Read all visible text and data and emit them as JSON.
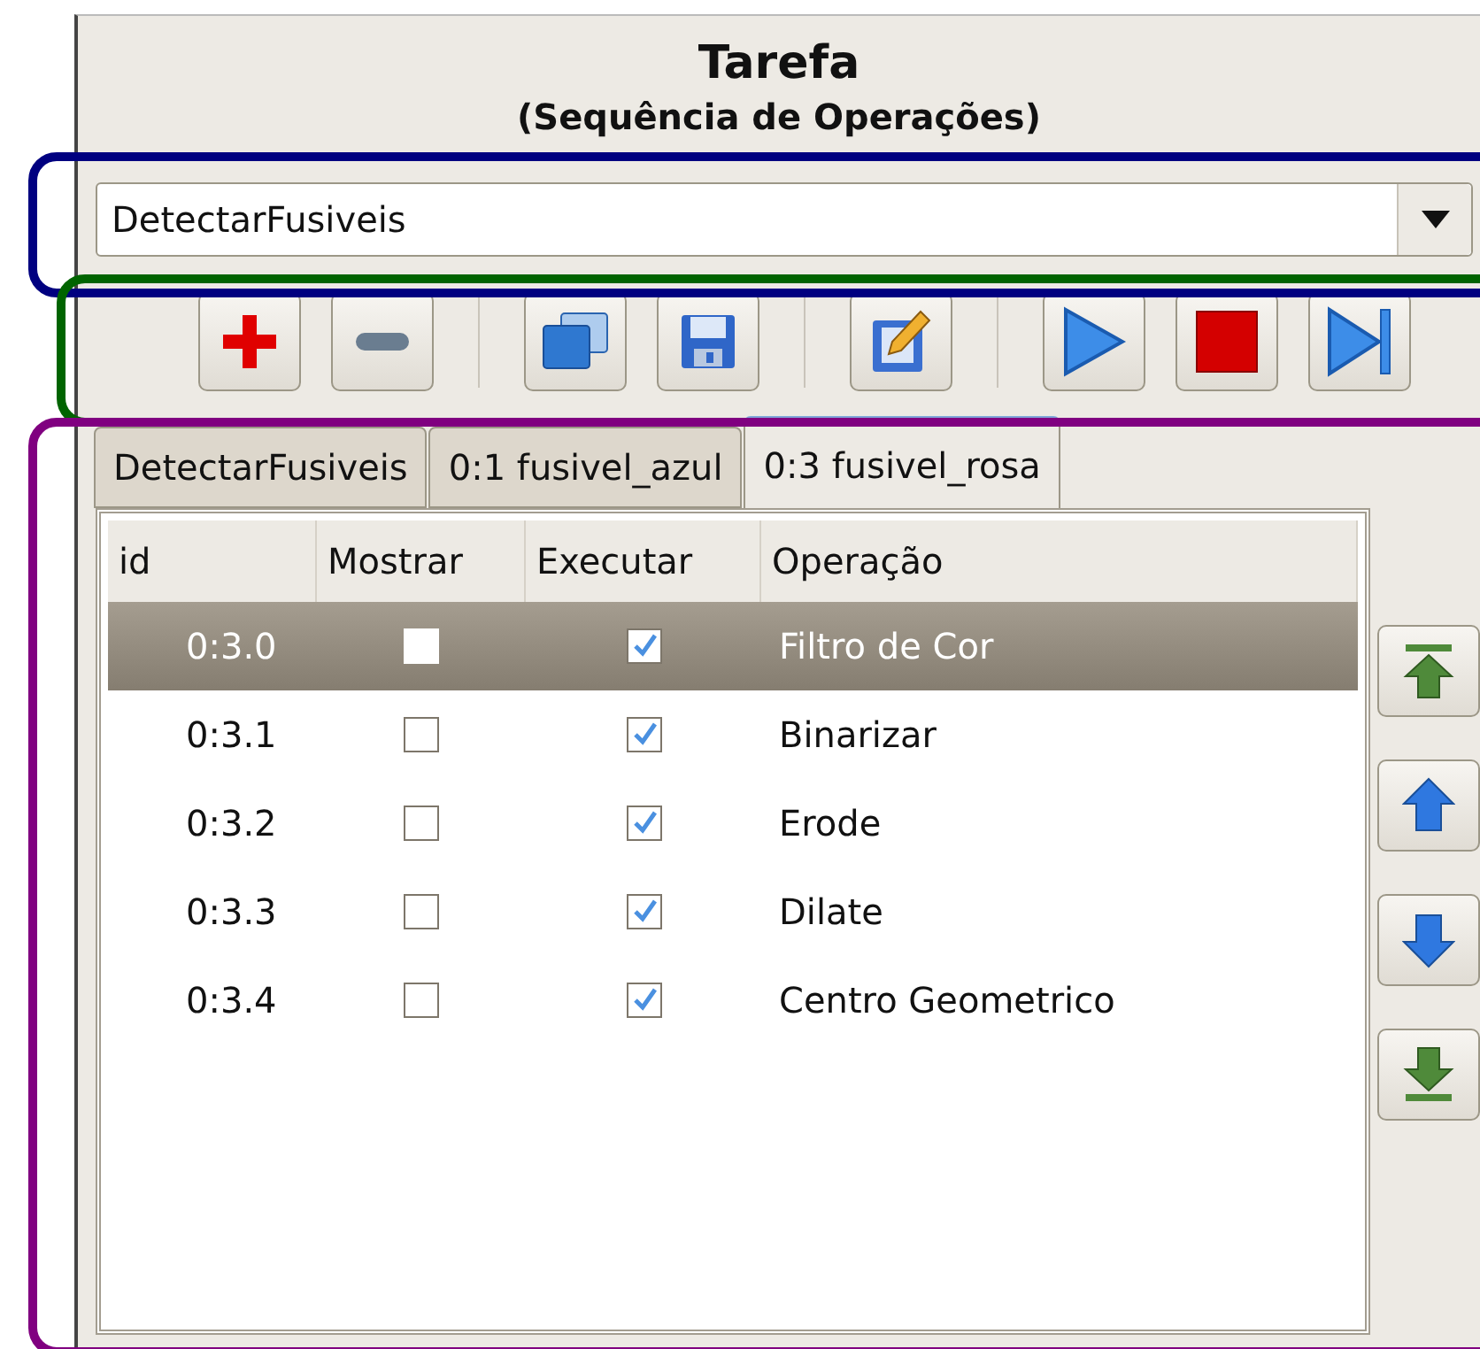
{
  "panel": {
    "title": "Tarefa",
    "subtitle": "(Sequência de Operações)"
  },
  "task_select": {
    "value": "DetectarFusiveis"
  },
  "toolbar": [
    {
      "kind": "add"
    },
    {
      "kind": "remove"
    },
    {
      "kind": "separator"
    },
    {
      "kind": "copy"
    },
    {
      "kind": "save"
    },
    {
      "kind": "separator"
    },
    {
      "kind": "edit"
    },
    {
      "kind": "separator"
    },
    {
      "kind": "play"
    },
    {
      "kind": "stop"
    },
    {
      "kind": "step"
    }
  ],
  "tabs": [
    {
      "label": "DetectarFusiveis",
      "selected": false
    },
    {
      "label": "0:1 fusivel_azul",
      "selected": false
    },
    {
      "label": "0:3 fusivel_rosa",
      "selected": true
    }
  ],
  "table": {
    "columns": [
      "id",
      "Mostrar",
      "Executar",
      "Operação"
    ],
    "rows": [
      {
        "id": "0:3.0",
        "show": false,
        "run": true,
        "operation": "Filtro de Cor",
        "selected": true
      },
      {
        "id": "0:3.1",
        "show": false,
        "run": true,
        "operation": "Binarizar",
        "selected": false
      },
      {
        "id": "0:3.2",
        "show": false,
        "run": true,
        "operation": "Erode",
        "selected": false
      },
      {
        "id": "0:3.3",
        "show": false,
        "run": true,
        "operation": "Dilate",
        "selected": false
      },
      {
        "id": "0:3.4",
        "show": false,
        "run": true,
        "operation": "Centro Geometrico",
        "selected": false
      }
    ]
  },
  "move_buttons": [
    {
      "kind": "top"
    },
    {
      "kind": "up"
    },
    {
      "kind": "down"
    },
    {
      "kind": "bottom"
    }
  ],
  "highlights": [
    {
      "color": "#000080"
    },
    {
      "color": "#006400"
    },
    {
      "color": "#800080"
    }
  ]
}
